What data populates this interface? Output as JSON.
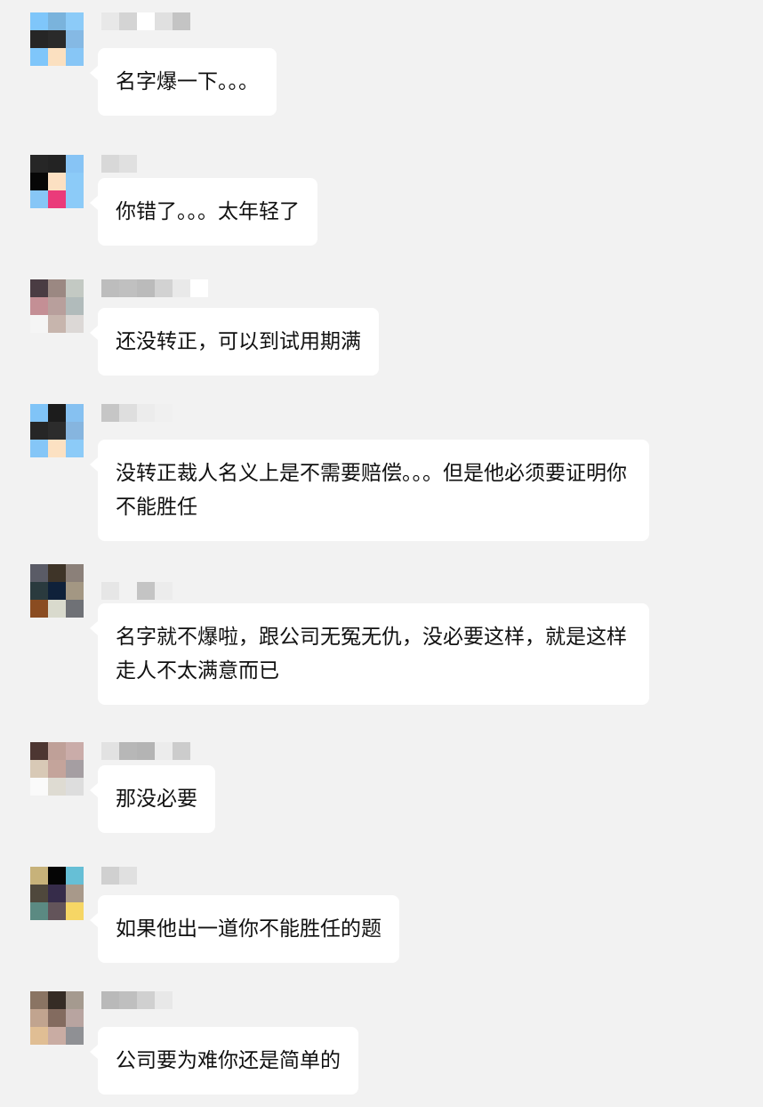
{
  "messages": [
    {
      "text": "名字爆一下。。。",
      "avatar": [
        "#7fc6fa",
        "#7ab3dc",
        "#8ccbf8",
        "#262626",
        "#2a2a2a",
        "#85b9e4",
        "#7fc6fa",
        "#fbe0c0",
        "#87c6f6"
      ],
      "name": [
        "#e8e8e8",
        "#d4d4d4",
        "#ffffff",
        "#e0e0e0",
        "#c4c4c4",
        "#f2f2f2"
      ]
    },
    {
      "text": "你错了。。。太年轻了",
      "avatar": [
        "#262626",
        "#232323",
        "#87c4f5",
        "#070707",
        "#fce0c2",
        "#8ccbf8",
        "#87c6f6",
        "#ea3b7a",
        "#8ccbf8"
      ],
      "name": [
        "#d8d8d8",
        "#e0e0e0",
        "#f2f2f2",
        "#f2f2f2",
        "#f2f2f2",
        "#f2f2f2"
      ]
    },
    {
      "text": "还没转正，可以到试用期满",
      "avatar": [
        "#4a3c43",
        "#9b8882",
        "#c3c9c3",
        "#c48f95",
        "#b89f9c",
        "#b1bbbb",
        "#f5f5f5",
        "#c7b5ad",
        "#dcd8d6"
      ],
      "name": [
        "#bdbdbd",
        "#c0c0c0",
        "#bbbbbb",
        "#d2d2d2",
        "#e9e9e9",
        "#ffffff",
        "#f2f2f2",
        "#f2f2f2",
        "#f2f2f2",
        "#f2f2f2",
        "#f2f2f2",
        "#f2f2f2"
      ]
    },
    {
      "text": "没转正裁人名义上是不需要赔偿。。。但是他必须要证明你不能胜任",
      "avatar": [
        "#80c4f7",
        "#1c1c1c",
        "#86c1f1",
        "#262626",
        "#2c2c2c",
        "#86b5df",
        "#85c6f7",
        "#fce1c2",
        "#8ccbf8"
      ],
      "name": [
        "#c6c6c6",
        "#dedede",
        "#ececec",
        "#f0f0f0",
        "#f2f2f2",
        "#f2f2f2"
      ]
    },
    {
      "text": "名字就不爆啦，跟公司无冤无仇，没必要这样，就是这样走人不太满意而已",
      "avatar": [
        "#5a5b66",
        "#3e3428",
        "#8b8079",
        "#2a3a3e",
        "#0f213a",
        "#a39783",
        "#8a4c21",
        "#d9dacd",
        "#6f7176"
      ],
      "name": [
        "#e6e6e6",
        "#f2f2f2",
        "#c4c4c4",
        "#ececec",
        "#f2f2f2",
        "#f2f2f2"
      ]
    },
    {
      "text": "那没必要",
      "avatar": [
        "#4d3632",
        "#bfa098",
        "#caaca9",
        "#d8c9b6",
        "#c4a49b",
        "#a59ea2",
        "#fafafa",
        "#dedbd2",
        "#dddddd"
      ],
      "name": [
        "#e2e2e2",
        "#b7b7b7",
        "#b4b4b4",
        "#ececec",
        "#cccccc",
        "#f2f2f2"
      ]
    },
    {
      "text": "如果他出一道你不能胜任的题",
      "avatar": [
        "#c7b27a",
        "#050505",
        "#66bfd6",
        "#4f483c",
        "#362c4a",
        "#a8998a",
        "#5b8a82",
        "#63545a",
        "#f6d665"
      ],
      "name": [
        "#d0d0d0",
        "#e0e0e0",
        "#f2f2f2",
        "#f2f2f2",
        "#f2f2f2",
        "#f2f2f2"
      ]
    },
    {
      "text": "公司要为难你还是简单的",
      "avatar": [
        "#8a7463",
        "#352c25",
        "#a59a8f",
        "#c1a48f",
        "#836b5f",
        "#b8a4a0",
        "#e0be94",
        "#c9aca3",
        "#8f9094"
      ],
      "name": [
        "#b9b9b9",
        "#bfbfbf",
        "#d0d0d0",
        "#e8e8e8",
        "#f2f2f2",
        "#f2f2f2",
        "#f2f2f2",
        "#f2f2f2",
        "#f2f2f2",
        "#f2f2f2",
        "#f2f2f2",
        "#f2f2f2"
      ]
    }
  ]
}
